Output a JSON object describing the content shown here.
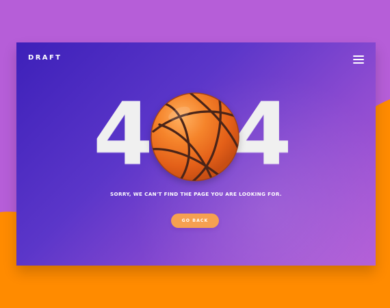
{
  "header": {
    "brand": "DRAFT"
  },
  "error": {
    "left_digit": "4",
    "middle_digit": "0",
    "right_digit": "4",
    "message": "SORRY, WE CAN'T FIND THE PAGE YOU ARE LOOKING FOR."
  },
  "actions": {
    "go_back": "GO BACK"
  },
  "icons": {
    "menu": "hamburger-menu-icon",
    "ball": "basketball-icon"
  },
  "colors": {
    "outer_purple": "#b65ed8",
    "outer_orange": "#ff8b00",
    "card_start": "#3d20b9",
    "card_end": "#b45ed7",
    "button": "#f6a051",
    "digit": "#f0f0f0",
    "ball": "#f27a20"
  }
}
